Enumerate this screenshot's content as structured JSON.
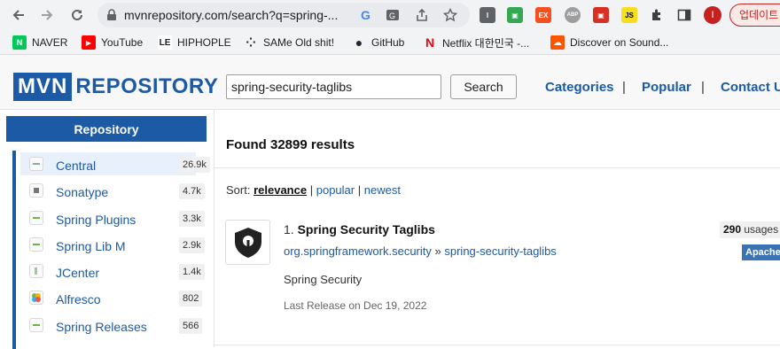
{
  "browser": {
    "url": "mvnrepository.com/search?q=spring-...",
    "update_label": "업데이트",
    "avatar_initial": "I",
    "extensions": [
      "I",
      "▣",
      "EX",
      "ABP",
      "▣",
      "JS"
    ]
  },
  "bookmarks": [
    {
      "label": "NAVER",
      "icon": "naver-icon",
      "color": "#03c75a",
      "glyph": "N"
    },
    {
      "label": "YouTube",
      "icon": "youtube-icon",
      "color": "#ff0000",
      "glyph": "▶"
    },
    {
      "label": "HIPHOPLE",
      "icon": "hiphople-icon",
      "color": "#222222",
      "glyph": "LE"
    },
    {
      "label": "SAMe Old shit!",
      "icon": "dots-icon",
      "color": "#333333",
      "glyph": "⁘"
    },
    {
      "label": "GitHub",
      "icon": "github-icon",
      "color": "#24292f",
      "glyph": "●"
    },
    {
      "label": "Netflix 대한민국 -...",
      "icon": "netflix-icon",
      "color": "#e50914",
      "glyph": "N"
    },
    {
      "label": "Discover on Sound...",
      "icon": "soundcloud-icon",
      "color": "#ff5500",
      "glyph": "☁"
    }
  ],
  "site": {
    "logo_mvn": "MVN",
    "logo_repo": "REPOSITORY",
    "search_value": "spring-security-taglibs",
    "search_button": "Search",
    "nav": [
      "Categories",
      "Popular",
      "Contact Us"
    ],
    "nav_sep": "|"
  },
  "sidebar": {
    "heading": "Repository",
    "items": [
      {
        "label": "Central",
        "count": "26.9k"
      },
      {
        "label": "Sonatype",
        "count": "4.7k"
      },
      {
        "label": "Spring Plugins",
        "count": "3.3k"
      },
      {
        "label": "Spring Lib M",
        "count": "2.9k"
      },
      {
        "label": "JCenter",
        "count": "1.4k"
      },
      {
        "label": "Alfresco",
        "count": "802"
      },
      {
        "label": "Spring Releases",
        "count": "566"
      }
    ]
  },
  "results": {
    "found_text": "Found 32899 results",
    "sort_label": "Sort:",
    "sort_options": [
      "relevance",
      "popular",
      "newest"
    ],
    "sort_sep": "|",
    "items": [
      {
        "index": "1.",
        "title": "Spring Security Taglibs",
        "group": "org.springframework.security",
        "arrow": "»",
        "artifact": "spring-security-taglibs",
        "description": "Spring Security",
        "last_release": "Last Release on Dec 19, 2022",
        "usages_count": "290",
        "usages_label": "usages",
        "license": "Apache"
      }
    ]
  },
  "colors": {
    "brand": "#1c5aa6",
    "license": "#3a72b6",
    "update": "#c5221f"
  }
}
